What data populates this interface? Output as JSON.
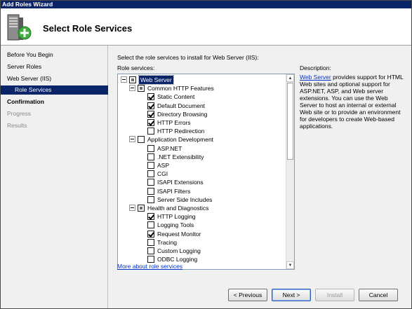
{
  "window": {
    "title": "Add Roles Wizard"
  },
  "banner": {
    "title": "Select Role Services",
    "icon": "server-add-icon"
  },
  "nav": {
    "items": [
      {
        "label": "Before You Begin",
        "state": "done"
      },
      {
        "label": "Server Roles",
        "state": "done"
      },
      {
        "label": "Web Server (IIS)",
        "state": "done"
      },
      {
        "label": "Role Services",
        "state": "selected"
      },
      {
        "label": "Confirmation",
        "state": "next"
      },
      {
        "label": "Progress",
        "state": "pending"
      },
      {
        "label": "Results",
        "state": "pending"
      }
    ]
  },
  "content": {
    "prompt": "Select the role services to install for Web Server (IIS):",
    "role_services_label": "Role services:",
    "description_label": "Description:",
    "more_link": "More about role services",
    "description": {
      "link_text": "Web Server",
      "text": " provides support for HTML Web sites and optional support for ASP.NET, ASP, and Web server extensions. You can use the Web Server to host an internal or external Web site or to provide an environment for developers to create Web-based applications."
    }
  },
  "tree": [
    {
      "label": "Web Server",
      "level": 0,
      "expander": true,
      "state": "partial",
      "highlight": true
    },
    {
      "label": "Common HTTP Features",
      "level": 1,
      "expander": true,
      "state": "partial"
    },
    {
      "label": "Static Content",
      "level": 2,
      "state": "checked"
    },
    {
      "label": "Default Document",
      "level": 2,
      "state": "checked"
    },
    {
      "label": "Directory Browsing",
      "level": 2,
      "state": "checked"
    },
    {
      "label": "HTTP Errors",
      "level": 2,
      "state": "checked"
    },
    {
      "label": "HTTP Redirection",
      "level": 2,
      "state": "unchecked"
    },
    {
      "label": "Application Development",
      "level": 1,
      "expander": true,
      "state": "unchecked"
    },
    {
      "label": "ASP.NET",
      "level": 2,
      "state": "unchecked"
    },
    {
      "label": ".NET Extensibility",
      "level": 2,
      "state": "unchecked"
    },
    {
      "label": "ASP",
      "level": 2,
      "state": "unchecked"
    },
    {
      "label": "CGI",
      "level": 2,
      "state": "unchecked"
    },
    {
      "label": "ISAPI Extensions",
      "level": 2,
      "state": "unchecked"
    },
    {
      "label": "ISAPI Filters",
      "level": 2,
      "state": "unchecked"
    },
    {
      "label": "Server Side Includes",
      "level": 2,
      "state": "unchecked"
    },
    {
      "label": "Health and Diagnostics",
      "level": 1,
      "expander": true,
      "state": "partial"
    },
    {
      "label": "HTTP Logging",
      "level": 2,
      "state": "checked"
    },
    {
      "label": "Logging Tools",
      "level": 2,
      "state": "unchecked"
    },
    {
      "label": "Request Monitor",
      "level": 2,
      "state": "checked"
    },
    {
      "label": "Tracing",
      "level": 2,
      "state": "unchecked"
    },
    {
      "label": "Custom Logging",
      "level": 2,
      "state": "unchecked"
    },
    {
      "label": "ODBC Logging",
      "level": 2,
      "state": "unchecked"
    }
  ],
  "buttons": {
    "previous": "< Previous",
    "next": "Next >",
    "install": "Install",
    "cancel": "Cancel"
  }
}
